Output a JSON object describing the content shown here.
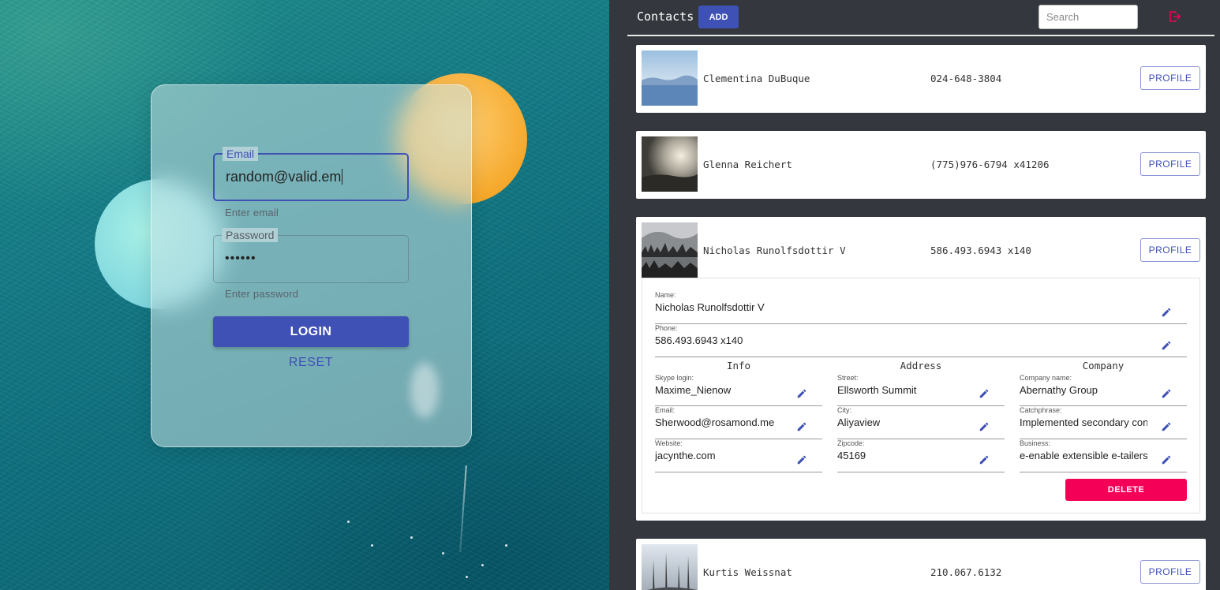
{
  "login": {
    "email_label": "Email",
    "email_value": "random@valid.em",
    "email_helper": "Enter email",
    "password_label": "Password",
    "password_value": "••••••",
    "password_helper": "Enter password",
    "login_label": "LOGIN",
    "reset_label": "RESET"
  },
  "header": {
    "title": "Contacts",
    "add_label": "ADD",
    "search_placeholder": "Search",
    "logout_icon": "logout-icon",
    "accent": "#3f51b5",
    "logout_color": "#f50057"
  },
  "contacts": [
    {
      "name": "Clementina DuBuque",
      "phone": "024-648-3804",
      "profile_label": "PROFILE"
    },
    {
      "name": "Glenna Reichert",
      "phone": "(775)976-6794 x41206",
      "profile_label": "PROFILE"
    },
    {
      "name": "Nicholas Runolfsdottir V",
      "phone": "586.493.6943 x140",
      "profile_label": "PROFILE"
    },
    {
      "name": "Kurtis Weissnat",
      "phone": "210.067.6132",
      "profile_label": "PROFILE"
    }
  ],
  "details": {
    "name_label": "Name:",
    "name_value": "Nicholas Runolfsdottir V",
    "phone_label": "Phone:",
    "phone_value": "586.493.6943 x140",
    "columns": {
      "info": "Info",
      "address": "Address",
      "company": "Company"
    },
    "info": {
      "skype_label": "Skype login:",
      "skype_value": "Maxime_Nienow",
      "email_label": "Email:",
      "email_value": "Sherwood@rosamond.me",
      "website_label": "Website:",
      "website_value": "jacynthe.com"
    },
    "address": {
      "street_label": "Street:",
      "street_value": "Ellsworth Summit",
      "city_label": "City:",
      "city_value": "Aliyaview",
      "zip_label": "Zipcode:",
      "zip_value": "45169"
    },
    "company": {
      "name_label": "Company name:",
      "name_value": "Abernathy Group",
      "catch_label": "Catchphrase:",
      "catch_value": "Implemented secondary concept",
      "bs_label": "Business:",
      "bs_value": "e-enable extensible e-tailers"
    },
    "delete_label": "DELETE",
    "delete_color": "#f50057"
  }
}
